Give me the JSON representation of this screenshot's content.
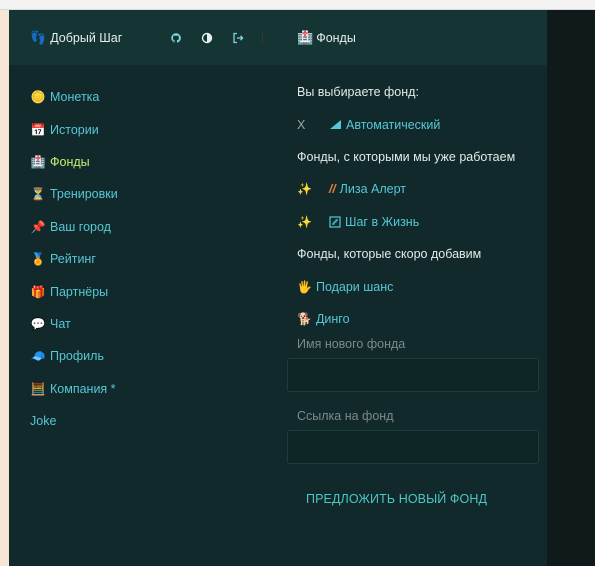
{
  "app": {
    "brand": "Добрый Шаг"
  },
  "header_icons": [
    "github-icon",
    "theme-toggle-icon",
    "logout-icon"
  ],
  "nav": [
    {
      "label": "Монетка",
      "icon": "coin-icon",
      "active": false
    },
    {
      "label": "Истории",
      "icon": "calendar-icon",
      "active": false
    },
    {
      "label": "Фонды",
      "icon": "hospital-icon",
      "active": true
    },
    {
      "label": "Тренировки",
      "icon": "hourglass-icon",
      "active": false
    },
    {
      "label": "Ваш город",
      "icon": "pushpin-icon",
      "active": false
    },
    {
      "label": "Рейтинг",
      "icon": "medal-icon",
      "active": false
    },
    {
      "label": "Партнёры",
      "icon": "gift-icon",
      "active": false
    },
    {
      "label": "Чат",
      "icon": "chat-icon",
      "active": false
    },
    {
      "label": "Профиль",
      "icon": "cap-icon",
      "active": false
    },
    {
      "label": "Компания *",
      "icon": "abacus-icon",
      "active": false
    },
    {
      "label": "Joke",
      "icon": "",
      "active": false
    }
  ],
  "page": {
    "title": "Фонды",
    "choose_label": "Вы выбираете фонд:",
    "selected": {
      "mark": "X",
      "name": "Автоматический"
    },
    "working_title": "Фонды, с которыми мы уже работаем",
    "working": [
      {
        "name": "Лиза Алерт",
        "icon": "slash-icon"
      },
      {
        "name": "Шаг в Жизнь",
        "icon": "step-icon"
      }
    ],
    "soon_title": "Фонды, которые скоро добавим",
    "soon": [
      {
        "name": "Подари шанс",
        "icon": "hand-icon"
      },
      {
        "name": "Динго",
        "icon": "dog-icon"
      }
    ],
    "new_name_label": "Имя нового фонда",
    "link_label": "Ссылка на фонд",
    "submit_label": "ПРЕДЛОЖИТЬ НОВЫЙ ФОНД"
  },
  "colors": {
    "accent": "#56c7d6",
    "active": "#c5ef76",
    "bg": "#11292a",
    "header_bg": "#153434"
  }
}
